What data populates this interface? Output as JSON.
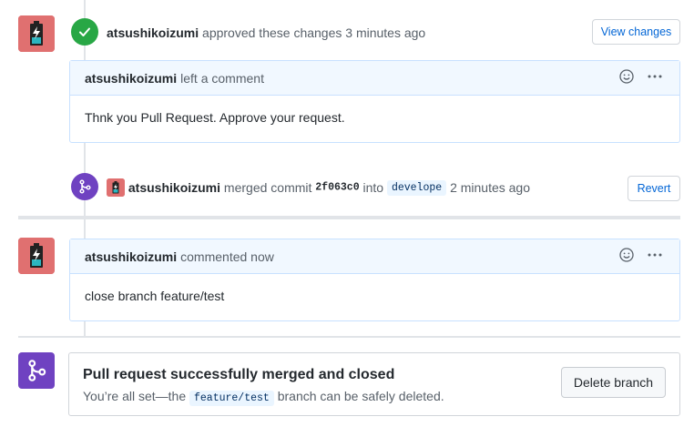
{
  "colors": {
    "approved_green": "#28a745",
    "merged_purple": "#6f42c1",
    "link_blue": "#0366d6",
    "comment_header_bg": "#f1f8ff",
    "comment_border": "#c8e1ff"
  },
  "review": {
    "user": "atsushikoizumi",
    "action": "approved these changes",
    "time": "3 minutes ago",
    "view_changes_label": "View changes"
  },
  "review_comment": {
    "user": "atsushikoizumi",
    "action": "left a comment",
    "body": "Thnk you Pull Request. Approve your request."
  },
  "merge_event": {
    "user": "atsushikoizumi",
    "action": "merged commit",
    "commit": "2f063c0",
    "into": "into",
    "branch": "develope",
    "time": "2 minutes ago",
    "revert_label": "Revert"
  },
  "comment": {
    "user": "atsushikoizumi",
    "action": "commented now",
    "body": "close branch feature/test"
  },
  "merge_status": {
    "title": "Pull request successfully merged and closed",
    "desc_before": "You’re all set—the",
    "branch": "feature/test",
    "desc_after": "branch can be safely deleted.",
    "delete_label": "Delete branch"
  },
  "icons": [
    "avatar-battery-icon",
    "check-icon",
    "smiley-icon",
    "kebab-icon",
    "git-merge-icon"
  ]
}
